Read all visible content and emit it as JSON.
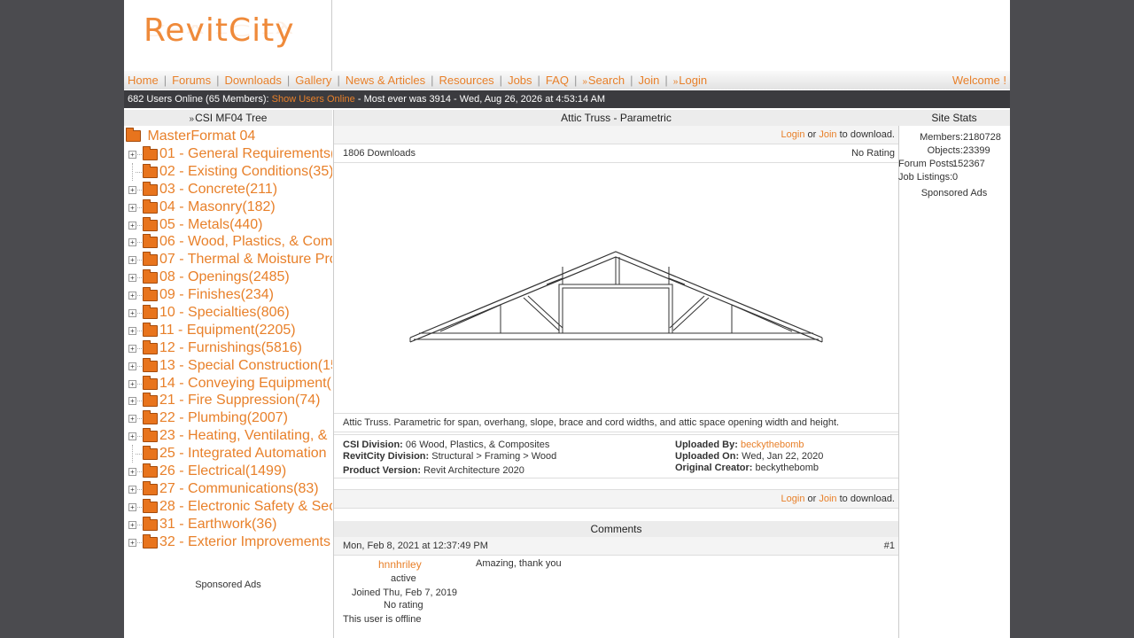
{
  "header": {
    "logo_text": "RevitCity",
    "colors": {
      "brand": "#e8802a",
      "dark_bar": "#3b3b3f",
      "page_bg": "#4b4b4f"
    }
  },
  "nav": {
    "items": [
      "Home",
      "Forums",
      "Downloads",
      "Gallery",
      "News & Articles",
      "Resources",
      "Jobs",
      "FAQ",
      "Search",
      "Join",
      "Login"
    ],
    "welcome": "Welcome !"
  },
  "online_bar": {
    "count_text": "682 Users Online (65 Members):",
    "show_link": "Show Users Online",
    "record_text": "- Most ever was 3914 - Wed, Aug 26, 2026 at 4:53:14 AM"
  },
  "left": {
    "title": "CSI MF04 Tree",
    "root": "MasterFormat 04",
    "items": [
      "01 - General Requirements(",
      "02 - Existing Conditions(35)",
      "03 - Concrete(211)",
      "04 - Masonry(182)",
      "05 - Metals(440)",
      "06 - Wood, Plastics, & Comp",
      "07 - Thermal & Moisture Pro",
      "08 - Openings(2485)",
      "09 - Finishes(234)",
      "10 - Specialties(806)",
      "11 - Equipment(2205)",
      "12 - Furnishings(5816)",
      "13 - Special Construction(15",
      "14 - Conveying Equipment(",
      "21 - Fire Suppression(74)",
      "22 - Plumbing(2007)",
      "23 - Heating, Ventilating, &",
      "25 - Integrated Automation",
      "26 - Electrical(1499)",
      "27 - Communications(83)",
      "28 - Electronic Safety & Sec",
      "31 - Earthwork(36)",
      "32 - Exterior Improvements"
    ],
    "sponsored": "Sponsored Ads"
  },
  "center": {
    "title": "Attic Truss - Parametric",
    "login": "Login",
    "or": "or",
    "join": "Join",
    "to_download": "to download.",
    "downloads": "1806 Downloads",
    "rating": "No Rating",
    "description": "Attic Truss.  Parametric for span, overhang, slope, brace and cord widths, and attic space opening width and height.",
    "meta": {
      "csi_label": "CSI Division:",
      "csi_value": "06 Wood, Plastics, & Composites",
      "rc_label": "RevitCity Division:",
      "rc_value": "Structural > Framing > Wood",
      "pv_label": "Product Version:",
      "pv_value": "Revit Architecture 2020",
      "ub_label": "Uploaded By:",
      "ub_value": "beckythebomb",
      "uo_label": "Uploaded On:",
      "uo_value": "Wed, Jan 22, 2020",
      "oc_label": "Original Creator:",
      "oc_value": "beckythebomb"
    },
    "comments": {
      "title": "Comments",
      "date": "Mon, Feb 8, 2021 at 12:37:49 PM",
      "num": "#1",
      "user": "hnnhriley",
      "status": "active",
      "joined": "Joined Thu, Feb 7, 2019",
      "rating": "No rating",
      "offline": "This user is offline",
      "text": "Amazing, thank you"
    }
  },
  "right": {
    "title": "Site Stats",
    "stats": [
      {
        "k": "Members:",
        "v": "2180728"
      },
      {
        "k": "Objects:",
        "v": "23399"
      },
      {
        "k": "Forum Posts:",
        "v": "152367"
      },
      {
        "k": "Job Listings:",
        "v": "0"
      }
    ],
    "sponsored": "Sponsored Ads"
  }
}
